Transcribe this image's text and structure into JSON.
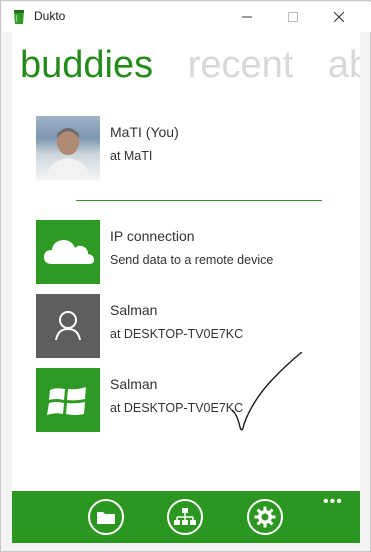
{
  "window": {
    "title": "Dukto",
    "minimize_glyph": "—",
    "maximize_glyph": "☐",
    "close_glyph": "✕"
  },
  "tabs": [
    {
      "label": "buddies",
      "active": true
    },
    {
      "label": "recent",
      "active": false
    },
    {
      "label": "ab",
      "active": false
    }
  ],
  "buddies": [
    {
      "title": "MaTI (You)",
      "subtitle": "at MaTI",
      "icon": "user-photo"
    },
    {
      "title": "IP connection",
      "subtitle": "Send data to a remote device",
      "icon": "cloud-icon"
    },
    {
      "title": "Salman",
      "subtitle": "at DESKTOP-TV0E7KC",
      "icon": "user-icon"
    },
    {
      "title": "Salman",
      "subtitle": "at DESKTOP-TV0E7KC",
      "icon": "windows-logo-icon"
    }
  ],
  "bottombar": {
    "buttons": [
      "folder-icon",
      "network-icon",
      "settings-gear-icon"
    ],
    "more_label": "•••"
  },
  "colors": {
    "accent": "#2b9620",
    "tab_inactive": "#d8d8d8",
    "tile_gray": "#5e5e5e"
  }
}
